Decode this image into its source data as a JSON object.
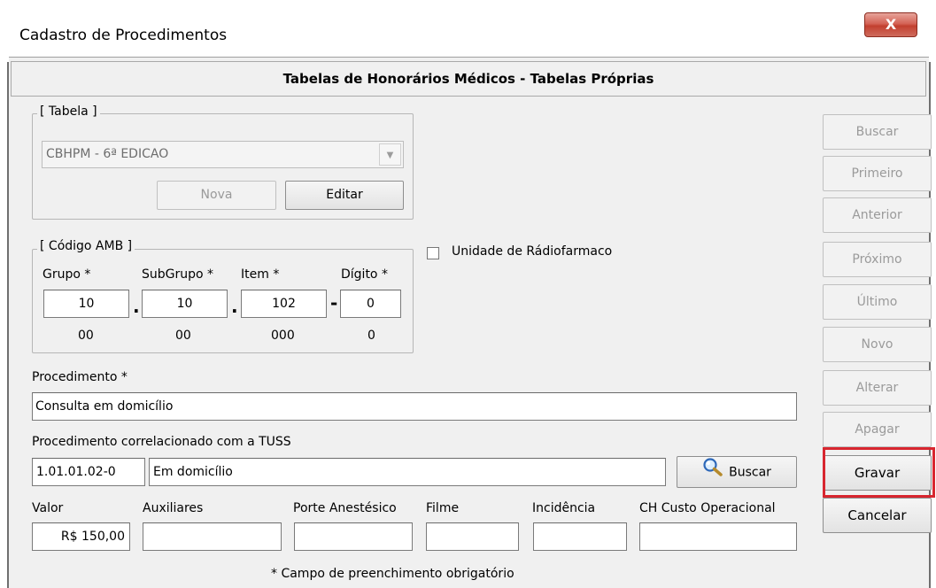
{
  "window": {
    "title": "Cadastro de Procedimentos",
    "close_glyph": "X",
    "header": "Tabelas de Honorários Médicos - Tabelas Próprias"
  },
  "tabela": {
    "legend": "[ Tabela ]",
    "selected": "CBHPM - 6ª EDICAO",
    "nova_label": "Nova",
    "editar_label": "Editar"
  },
  "codigo_amb": {
    "legend": "[ Código AMB ]",
    "grupo_label": "Grupo *",
    "subgrupo_label": "SubGrupo *",
    "item_label": "Item *",
    "digito_label": "Dígito *",
    "grupo_value": "10",
    "subgrupo_value": "10",
    "item_value": "102",
    "digito_value": "0",
    "sep_dot": ".",
    "sep_dash": "-",
    "grupo_hint": "00",
    "subgrupo_hint": "00",
    "item_hint": "000",
    "digito_hint": "0"
  },
  "radiofarmaco": {
    "label": "Unidade de Rádiofarmaco",
    "checked": false
  },
  "procedimento": {
    "label": "Procedimento *",
    "value": "Consulta em domicílio"
  },
  "tuss": {
    "label": "Procedimento correlacionado com a TUSS",
    "code": "1.01.01.02-0",
    "description": "Em domicílio",
    "buscar_label": "Buscar",
    "buscar_icon": "magnifier-icon"
  },
  "valores": {
    "valor_label": "Valor",
    "valor_value": "R$ 150,00",
    "auxiliares_label": "Auxiliares",
    "auxiliares_value": "",
    "porte_label": "Porte Anestésico",
    "porte_value": "",
    "filme_label": "Filme",
    "filme_value": "",
    "incidencia_label": "Incidência",
    "incidencia_value": "",
    "ch_label": "CH Custo Operacional",
    "ch_value": ""
  },
  "footer_note": "* Campo de preenchimento obrigatório",
  "side_buttons": {
    "buscar": "Buscar",
    "primeiro": "Primeiro",
    "anterior": "Anterior",
    "proximo": "Próximo",
    "ultimo": "Último",
    "novo": "Novo",
    "alterar": "Alterar",
    "apagar": "Apagar",
    "gravar": "Gravar",
    "cancelar": "Cancelar"
  },
  "colors": {
    "highlight": "#d8262f",
    "close_button": "#c2402f",
    "disabled_text": "#9a9a9a"
  }
}
